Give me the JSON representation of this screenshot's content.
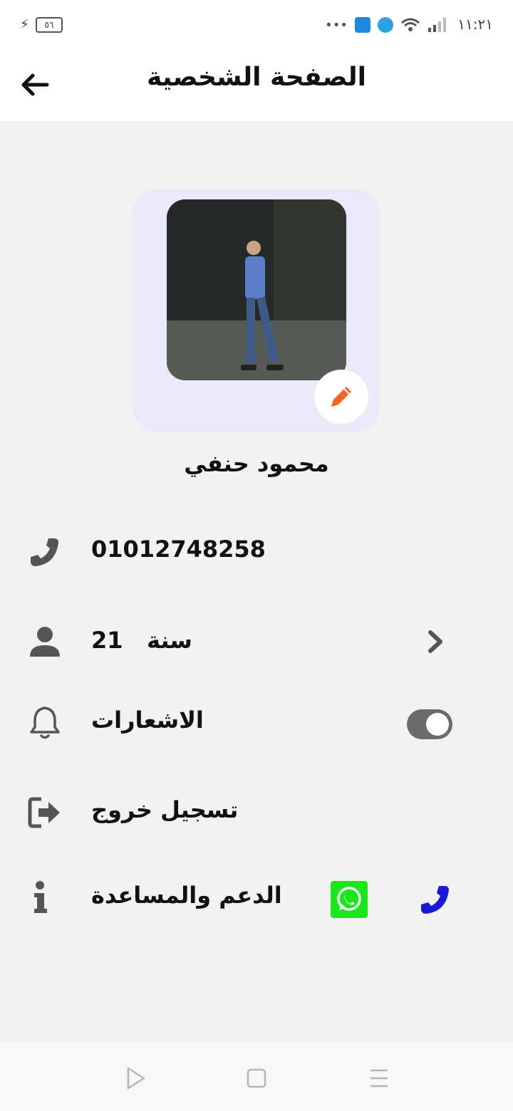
{
  "status_bar": {
    "time": "١١:٢١",
    "battery": "٥٦"
  },
  "header": {
    "title": "الصفحة الشخصية"
  },
  "profile": {
    "name": "محمود حنفي"
  },
  "rows": {
    "phone": "01012748258",
    "age_number": "21",
    "age_unit": "سنة",
    "notifications_label": "الاشعارات",
    "notifications_enabled": true,
    "logout_label": "تسجيل خروج",
    "support_label": "الدعم والمساعدة"
  },
  "colors": {
    "accent_orange": "#f26522",
    "call_blue": "#1a1ad6",
    "whatsapp_green": "#19e619",
    "avatar_bg": "#ece9fb",
    "icon_gray": "#555555"
  },
  "icons": [
    "back-arrow-icon",
    "pencil-icon",
    "phone-icon",
    "user-icon",
    "chevron-right-icon",
    "bell-icon",
    "logout-icon",
    "info-icon",
    "whatsapp-icon",
    "call-icon"
  ]
}
